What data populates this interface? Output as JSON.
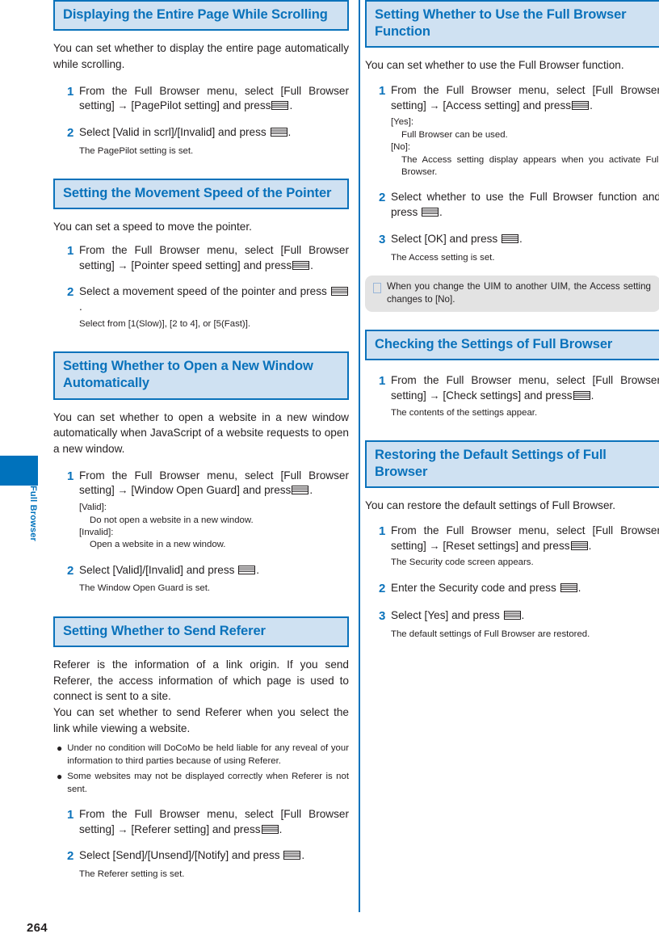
{
  "page": {
    "number": "264",
    "side_tab_label": "Full Browser",
    "accent_color": "#0a72bb",
    "heading_bg_color": "#cfe1f2",
    "note_bg_color": "#e3e3e3"
  },
  "icons": {
    "select_key": "select-key-icon",
    "note_marker": "note-marker-icon",
    "arrow": "→",
    "bullet": "●"
  },
  "left_column": {
    "section1": {
      "heading": "Displaying the Entire Page While Scrolling",
      "intro": "You can set whether to display the entire page automatically while scrolling.",
      "steps": [
        {
          "num": "1",
          "text_a": "From the Full Browser menu, select [Full Browser setting]",
          "text_b": "[PagePilot setting] and press",
          "text_c": "."
        },
        {
          "num": "2",
          "text_a": "Select [Valid in scrl]/[Invalid] and press",
          "text_c": ".",
          "sub": "The PagePilot setting is set."
        }
      ]
    },
    "section2": {
      "heading": "Setting the Movement Speed of the Pointer",
      "intro": "You can set a speed to move the pointer.",
      "steps": [
        {
          "num": "1",
          "text_a": "From the Full Browser menu, select [Full Browser setting]",
          "text_b": "[Pointer speed setting] and press",
          "text_c": "."
        },
        {
          "num": "2",
          "text_a": "Select a movement speed of the pointer and press",
          "text_c": ".",
          "sub": "Select from [1(Slow)], [2 to 4], or [5(Fast)]."
        }
      ]
    },
    "section3": {
      "heading": "Setting Whether to Open a New Window Automatically",
      "intro": "You can set whether to open a website in a new window automatically when JavaScript of a website requests to open a new window.",
      "steps": [
        {
          "num": "1",
          "text_a": "From the Full Browser menu, select [Full Browser setting]",
          "text_b": "[Window Open Guard] and press",
          "text_c": ".",
          "defs": [
            {
              "term": "[Valid]:",
              "desc": "Do not open a website in a new window."
            },
            {
              "term": "[Invalid]:",
              "desc": "Open a website in a new window."
            }
          ]
        },
        {
          "num": "2",
          "text_a": "Select [Valid]/[Invalid] and press",
          "text_c": ".",
          "sub": "The Window Open Guard is set."
        }
      ]
    },
    "section4": {
      "heading": "Setting Whether to Send Referer",
      "intro1": "Referer is the information of a link origin. If you send Referer, the access information of which page is used to connect is sent to a site.",
      "intro2": "You can set whether to send Referer when you select the link while viewing a website.",
      "bullets": [
        "Under no condition will DoCoMo be held liable for any reveal of your information to third parties because of using Referer.",
        "Some websites may not be displayed correctly when Referer is not sent."
      ],
      "steps": [
        {
          "num": "1",
          "text_a": "From the Full Browser menu, select [Full Browser setting]",
          "text_b": "[Referer setting] and press",
          "text_c": "."
        },
        {
          "num": "2",
          "text_a": "Select [Send]/[Unsend]/[Notify] and press",
          "text_c": ".",
          "sub": "The Referer setting is set."
        }
      ]
    }
  },
  "right_column": {
    "section1": {
      "heading": "Setting Whether to Use the Full Browser Function",
      "intro": "You can set whether to use the Full Browser function.",
      "steps": [
        {
          "num": "1",
          "text_a": "From the Full Browser menu, select [Full Browser setting]",
          "text_b": "[Access setting] and press",
          "text_c": ".",
          "defs": [
            {
              "term": "[Yes]:",
              "desc": "Full Browser can be used."
            },
            {
              "term": "[No]:",
              "desc": "The Access setting display appears when you activate Full Browser."
            }
          ]
        },
        {
          "num": "2",
          "text_a": "Select whether to use the Full Browser function and press",
          "text_c": "."
        },
        {
          "num": "3",
          "text_a": "Select [OK] and press",
          "text_c": ".",
          "sub": "The Access setting is set."
        }
      ],
      "note": "When you change the UIM to another UIM, the Access setting changes to [No]."
    },
    "section2": {
      "heading": "Checking the Settings of Full Browser",
      "steps": [
        {
          "num": "1",
          "text_a": "From the Full Browser menu, select [Full Browser setting]",
          "text_b": "[Check settings] and press",
          "text_c": ".",
          "sub": "The contents of the settings appear."
        }
      ]
    },
    "section3": {
      "heading": "Restoring the Default Settings of Full Browser",
      "intro": "You can restore the default settings of Full Browser.",
      "steps": [
        {
          "num": "1",
          "text_a": "From the Full Browser menu, select [Full Browser setting]",
          "text_b": "[Reset settings] and press",
          "text_c": ".",
          "sub": "The Security code screen appears."
        },
        {
          "num": "2",
          "text_a": "Enter the Security code and press",
          "text_c": "."
        },
        {
          "num": "3",
          "text_a": "Select [Yes] and press",
          "text_c": ".",
          "sub": "The default settings of Full Browser are restored."
        }
      ]
    }
  }
}
